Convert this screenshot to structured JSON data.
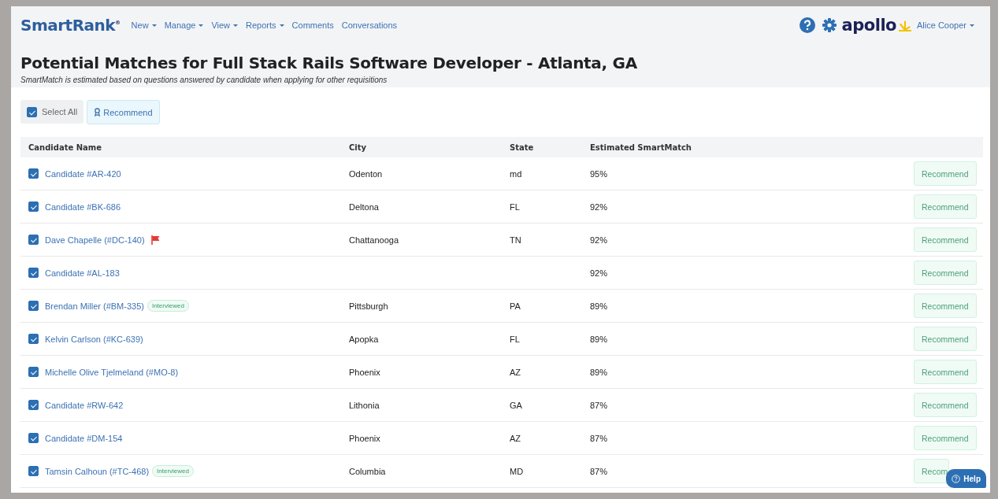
{
  "header": {
    "logo": "SmartRank$^{®}$",
    "nav": [
      {
        "label": "New",
        "dropdown": true
      },
      {
        "label": "Manage",
        "dropdown": true
      },
      {
        "label": "View",
        "dropdown": true
      },
      {
        "label": "Reports",
        "dropdown": true
      },
      {
        "label": "Comments",
        "dropdown": false
      },
      {
        "label": "Conversations",
        "dropdown": false
      }
    ],
    "brand": "apollo",
    "user": {
      "label": "Alice Cooper",
      "dropdown": true
    }
  },
  "page": {
    "title": "Potential Matches for Full Stack Rails Software Developer - Atlanta, GA",
    "subtitle": "SmartMatch is estimated based on questions answered by candidate when applying for other requisitions"
  },
  "toolbar": {
    "select_all": {
      "label": "Select All",
      "checked": true
    },
    "recommend": "Recommend"
  },
  "table": {
    "columns": [
      "Candidate Name",
      "City",
      "State",
      "Estimated SmartMatch"
    ],
    "rows": [
      {
        "checked": true,
        "name": "Candidate #AR-420",
        "flagged": false,
        "city": "Odenton",
        "state": "md",
        "match": "95%",
        "action": "Recommend"
      },
      {
        "checked": true,
        "name": "Candidate #BK-686",
        "flagged": false,
        "city": "Deltona",
        "state": "FL",
        "match": "92%",
        "action": "Recommend"
      },
      {
        "checked": true,
        "name": "Dave Chapelle (#DC-140)",
        "flagged": true,
        "city": "Chattanooga",
        "state": "TN",
        "match": "92%",
        "action": "Recommend"
      },
      {
        "checked": true,
        "name": "Candidate #AL-183",
        "flagged": false,
        "match": "92%",
        "action": "Recommend"
      },
      {
        "checked": true,
        "name": "Brendan Miller (#BM-335)",
        "flagged": false,
        "tag": "Interviewed",
        "city": "Pittsburgh",
        "state": "PA",
        "match": "89%",
        "action": "Recommend"
      },
      {
        "checked": true,
        "name": "Kelvin Carlson (#KC-639)",
        "flagged": false,
        "city": "Apopka",
        "state": "FL",
        "match": "89%",
        "action": "Recommend"
      },
      {
        "checked": true,
        "name": "Michelle Olive Tjelmeland (#MO-8)",
        "flagged": false,
        "city": "Phoenix",
        "state": "AZ",
        "match": "89%",
        "action": "Recommend"
      },
      {
        "checked": true,
        "name": "Candidate #RW-642",
        "flagged": false,
        "city": "Lithonia",
        "state": "GA",
        "match": "87%",
        "action": "Recommend"
      },
      {
        "checked": true,
        "name": "Candidate #DM-154",
        "flagged": false,
        "city": "Phoenix",
        "state": "AZ",
        "match": "87%",
        "action": "Recommend"
      },
      {
        "checked": true,
        "name": "Tamsin Calhoun (#TC-468)",
        "flagged": false,
        "tag": "Interviewed",
        "city": "Columbia",
        "state": "MD",
        "match": "87%",
        "action": "Recom"
      }
    ]
  },
  "help_button": "Help"
}
